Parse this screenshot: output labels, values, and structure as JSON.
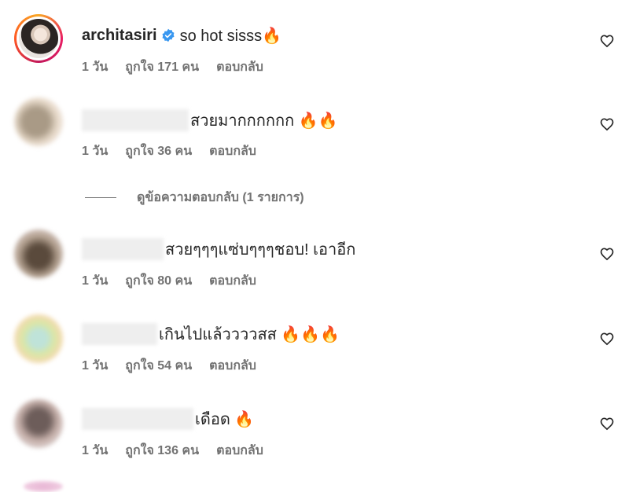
{
  "comments": [
    {
      "username": "architasiri",
      "verified": true,
      "text": "so hot sisss🔥",
      "time": "1 วัน",
      "likes": "ถูกใจ 171 คน",
      "reply": "ตอบกลับ"
    },
    {
      "username": "",
      "text": "สวยมากกกกกก 🔥🔥",
      "time": "1 วัน",
      "likes": "ถูกใจ 36 คน",
      "reply": "ตอบกลับ"
    },
    {
      "username": "",
      "text": "สวยๆๆๆแซ่บๆๆๆชอบ! เอาอีก",
      "time": "1 วัน",
      "likes": "ถูกใจ 80 คน",
      "reply": "ตอบกลับ"
    },
    {
      "username": "",
      "text": "เกินไปแล้ววววสส 🔥🔥🔥",
      "time": "1 วัน",
      "likes": "ถูกใจ 54 คน",
      "reply": "ตอบกลับ"
    },
    {
      "username": "",
      "text": "เดือด 🔥",
      "time": "1 วัน",
      "likes": "ถูกใจ 136 คน",
      "reply": "ตอบกลับ"
    }
  ],
  "view_replies": "ดูข้อความตอบกลับ (1 รายการ)",
  "icons": {
    "verified": "verified-badge-icon",
    "like": "heart-outline-icon"
  },
  "colors": {
    "verified_blue": "#3897f0",
    "secondary_text": "#737373",
    "primary_text": "#262626"
  }
}
